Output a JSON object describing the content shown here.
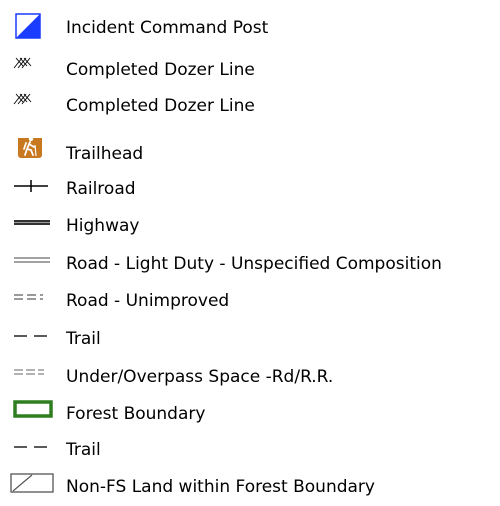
{
  "legend": {
    "items": [
      {
        "label": "Incident Command Post",
        "symbol": "incident-command-post-icon",
        "color": "#1a3cff"
      },
      {
        "label": "Completed Dozer Line",
        "symbol": "completed-dozer-line-icon",
        "color": "#000000"
      },
      {
        "label": "Completed Dozer Line",
        "symbol": "completed-dozer-line-icon",
        "color": "#000000"
      },
      {
        "label": "Trailhead",
        "symbol": "trailhead-hiker-icon",
        "color": "#c8781e"
      },
      {
        "label": "Railroad",
        "symbol": "railroad-line-icon",
        "color": "#000000"
      },
      {
        "label": "Highway",
        "symbol": "highway-line-icon",
        "color": "#333333"
      },
      {
        "label": "Road - Light Duty - Unspecified Composition",
        "symbol": "road-light-duty-line-icon",
        "color": "#333333"
      },
      {
        "label": "Road - Unimproved",
        "symbol": "road-unimproved-line-icon",
        "color": "#333333"
      },
      {
        "label": "Trail",
        "symbol": "trail-dashed-line-icon",
        "color": "#000000"
      },
      {
        "label": "Under/Overpass Space -Rd/R.R.",
        "symbol": "under-overpass-line-icon",
        "color": "#555555"
      },
      {
        "label": "Forest Boundary",
        "symbol": "forest-boundary-icon",
        "color": "#2e7d1e"
      },
      {
        "label": "Trail",
        "symbol": "trail-dashed-line-icon",
        "color": "#000000"
      },
      {
        "label": "Non-FS Land within Forest Boundary",
        "symbol": "non-fs-land-icon",
        "color": "#555555"
      }
    ]
  }
}
